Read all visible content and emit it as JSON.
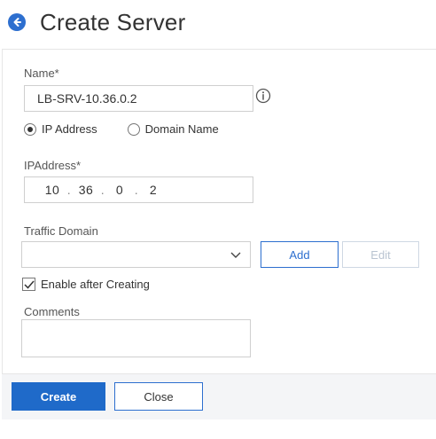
{
  "header": {
    "title": "Create Server"
  },
  "form": {
    "name_label": "Name*",
    "name_value": "LB-SRV-10.36.0.2",
    "radio_ip_label": "IP Address",
    "radio_domain_label": "Domain Name",
    "ip_label": "IPAddress*",
    "ip_octets": [
      "10",
      "36",
      "0",
      "2"
    ],
    "traffic_domain_label": "Traffic Domain",
    "traffic_domain_value": "",
    "add_label": "Add",
    "edit_label": "Edit",
    "enable_label": "Enable after Creating",
    "comments_label": "Comments",
    "comments_value": ""
  },
  "footer": {
    "create_label": "Create",
    "close_label": "Close"
  },
  "icons": {
    "back": "back-arrow-icon",
    "info": "info-icon",
    "chevron": "chevron-down-icon",
    "check": "check-icon"
  },
  "colors": {
    "accent": "#2d6fcf",
    "primary_button": "#1f6ac9",
    "disabled_text": "#b9c4d1",
    "footer_bg": "#f4f5f7"
  },
  "state": {
    "selected_radio": "IP Address",
    "enable_checked": true
  }
}
